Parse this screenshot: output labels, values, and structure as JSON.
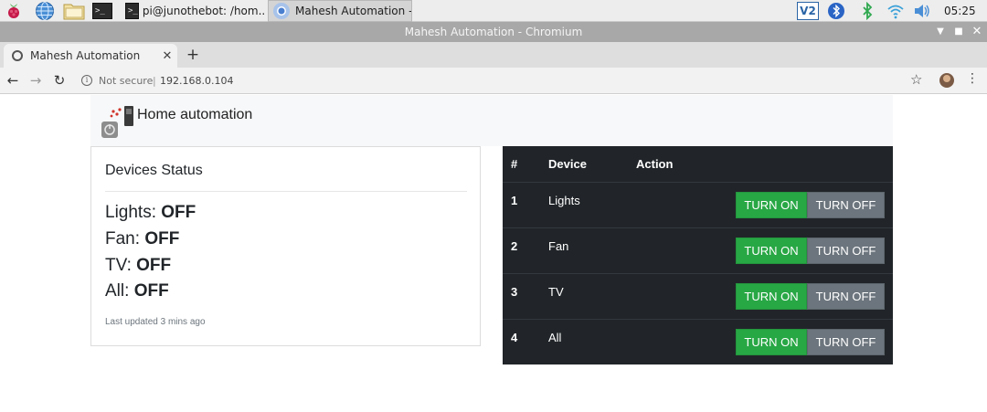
{
  "taskbar": {
    "tasks": [
      {
        "label": "pi@junothebot: /hom..."
      },
      {
        "label": "Mahesh Automation -..."
      }
    ],
    "clock": "05:25"
  },
  "window": {
    "title": "Mahesh Automation - Chromium"
  },
  "browser": {
    "tab_title": "Mahesh Automation",
    "security_label": "Not secure",
    "url": "192.168.0.104"
  },
  "page": {
    "brand": "Home automation",
    "status": {
      "title": "Devices Status",
      "items": [
        {
          "label": "Lights:",
          "value": "OFF"
        },
        {
          "label": "Fan:",
          "value": "OFF"
        },
        {
          "label": "TV:",
          "value": "OFF"
        },
        {
          "label": "All:",
          "value": "OFF"
        }
      ],
      "updated": "Last updated 3 mins ago"
    },
    "table": {
      "headers": [
        "#",
        "Device",
        "Action"
      ],
      "rows": [
        {
          "num": "1",
          "device": "Lights",
          "on": "TURN ON",
          "off": "TURN OFF"
        },
        {
          "num": "2",
          "device": "Fan",
          "on": "TURN ON",
          "off": "TURN OFF"
        },
        {
          "num": "3",
          "device": "TV",
          "on": "TURN ON",
          "off": "TURN OFF"
        },
        {
          "num": "4",
          "device": "All",
          "on": "TURN ON",
          "off": "TURN OFF"
        }
      ]
    }
  },
  "colors": {
    "accent_green": "#28a745",
    "secondary_gray": "#6c757d",
    "table_dark": "#212529"
  }
}
